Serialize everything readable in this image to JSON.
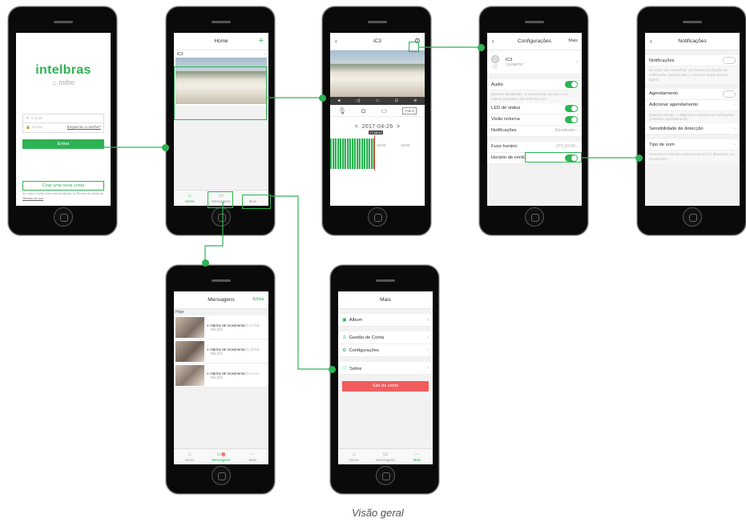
{
  "brand": {
    "name": "intelbras",
    "sub": "mibo"
  },
  "login": {
    "email_placeholder": "E-mail",
    "password_placeholder": "Senha",
    "forgot": "Esqueceu a senha?",
    "enter": "Entrar",
    "create": "Criar uma nova conta",
    "terms_note": "Ao criar a conta você está aceitando os Termos da Intelbras",
    "terms_link": "Termos de uso"
  },
  "home": {
    "title": "Home",
    "plus": "+",
    "camera": "iC3"
  },
  "tabs": {
    "home": "Home",
    "messages": "Mensagens",
    "more": "Mais",
    "badge": "2"
  },
  "player": {
    "title": "iC3",
    "date": "2017-04-26",
    "prev": "<",
    "next": ">",
    "patrol": "Patrol",
    "time_marker": "17:48:43",
    "t1": "18:00",
    "t2": "19:00"
  },
  "config": {
    "title": "Configurações",
    "more": "Mais",
    "device_name": "iC3",
    "device_id": "711068797",
    "audio": "Áudio",
    "audio_note": "Quando desativado, a visualização ao vivo e os vídeos gravados não emitirão som.",
    "led": "LED de status",
    "night": "Visão noturna",
    "notifications": "Notificações",
    "notifications_value": "Desativado",
    "timezone": "Fuso horário",
    "timezone_value": "UTC-03:00",
    "dst": "Horário de verão"
  },
  "notif": {
    "title": "Notificações",
    "notifications": "Notificações",
    "note1": "Se você não especificar um horário na função de notificação, quando ativo, o serviço ficará sempre ligado.",
    "schedule": "Agendamento",
    "add_schedule": "Adicionar agendamento",
    "note2": "Quando ativado, o dispositivo enviará as notificações conforme agendamento.",
    "sensitivity": "Sensibilidade de detecção",
    "sound": "Tipo de som",
    "note3": "Somente é enviado aviso sonoro ao for detectado um movimento."
  },
  "messages": {
    "title": "Mensagens",
    "edit": "Editar",
    "today": "Hoje",
    "items": [
      {
        "title": "Alarme de movimento",
        "time": "01:17:03",
        "device": "Dis:iC3"
      },
      {
        "title": "Alarme de movimento",
        "time": "01:16:03",
        "device": "Dis:iC3"
      },
      {
        "title": "Alarme de movimento",
        "time": "01:14:42",
        "device": "Dis:iC3"
      }
    ]
  },
  "more": {
    "title": "Mais",
    "album": "Álbum",
    "account": "Gestão de Conta",
    "settings": "Configurações",
    "about": "Sobre",
    "logout": "Sair da conta"
  },
  "caption": "Visão geral",
  "colors": {
    "accent": "#2db354",
    "logout": "#f25c5c"
  }
}
